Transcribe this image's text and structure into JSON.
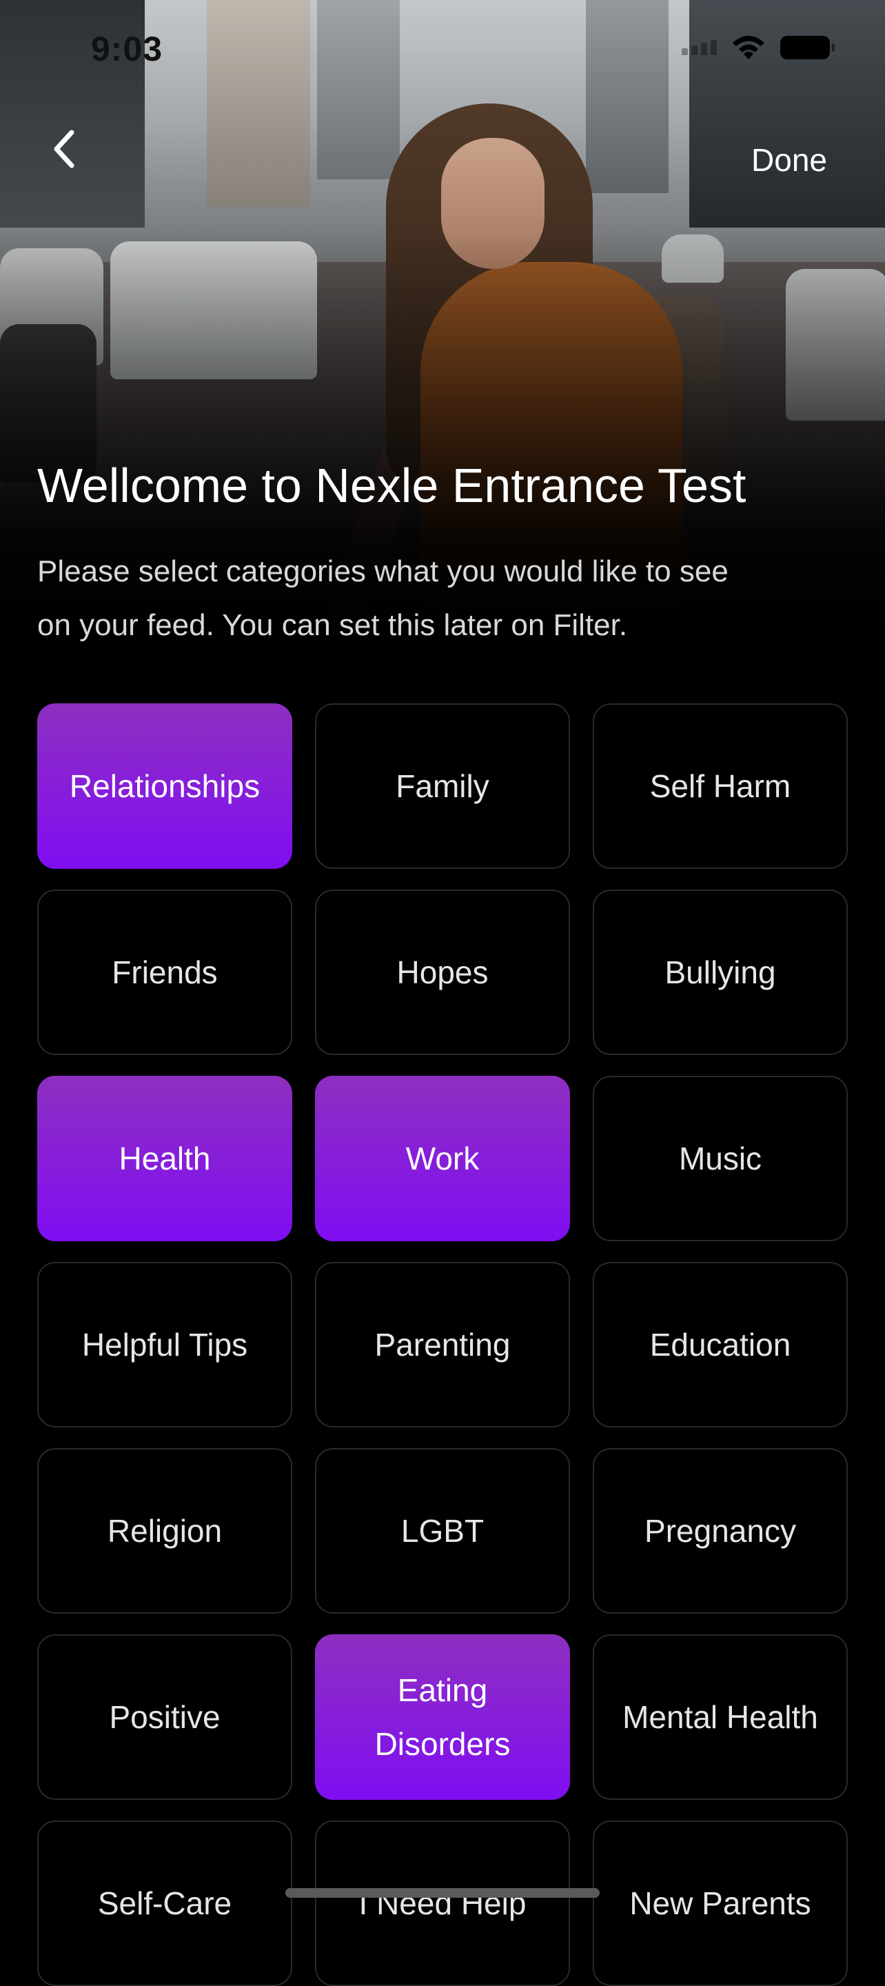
{
  "status_bar": {
    "time": "9:03"
  },
  "nav": {
    "back_icon": "chevron-left-icon",
    "done_label": "Done"
  },
  "header": {
    "title": "Wellcome to Nexle Entrance Test",
    "subtitle": "Please select categories what you would like to see on your feed. You can set this later on Filter."
  },
  "colors": {
    "background": "#000000",
    "selected_top": "#8e2fc0",
    "selected_bottom": "#7f0ef2",
    "tile_border": "#2a2a2a"
  },
  "categories": [
    {
      "label": "Relationships",
      "selected": true
    },
    {
      "label": "Family",
      "selected": false
    },
    {
      "label": "Self Harm",
      "selected": false
    },
    {
      "label": "Friends",
      "selected": false
    },
    {
      "label": "Hopes",
      "selected": false
    },
    {
      "label": "Bullying",
      "selected": false
    },
    {
      "label": "Health",
      "selected": true
    },
    {
      "label": "Work",
      "selected": true
    },
    {
      "label": "Music",
      "selected": false
    },
    {
      "label": "Helpful Tips",
      "selected": false
    },
    {
      "label": "Parenting",
      "selected": false
    },
    {
      "label": "Education",
      "selected": false
    },
    {
      "label": "Religion",
      "selected": false
    },
    {
      "label": "LGBT",
      "selected": false
    },
    {
      "label": "Pregnancy",
      "selected": false
    },
    {
      "label": "Positive",
      "selected": false
    },
    {
      "label": "Eating Disorders",
      "selected": true
    },
    {
      "label": "Mental Health",
      "selected": false
    },
    {
      "label": "Self-Care",
      "selected": false
    },
    {
      "label": "I Need Help",
      "selected": false
    },
    {
      "label": "New Parents",
      "selected": false
    }
  ]
}
